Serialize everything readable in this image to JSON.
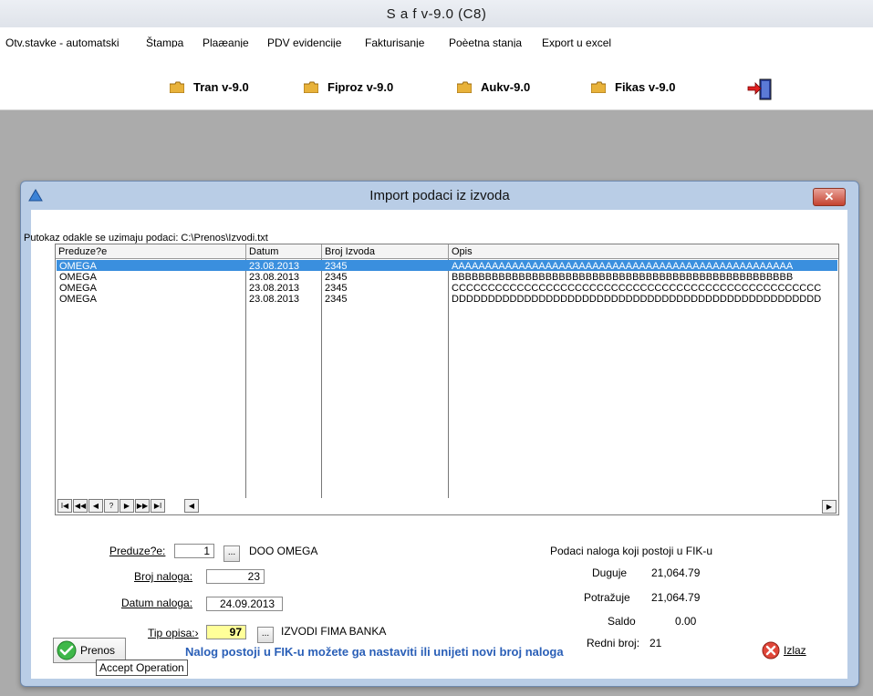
{
  "app": {
    "title": "S a f  v-9.0 (C8)"
  },
  "menu": [
    "Otv.stavke - automatski",
    "Štampa",
    "Plaæanje",
    "PDV evidencije",
    "Fakturisanje",
    "Poèetna stanja",
    "Export u excel"
  ],
  "toolbar": {
    "buttons": [
      "Tran v-9.0",
      "Fiproz v-9.0",
      "Aukv-9.0",
      "Fikas v-9.0"
    ],
    "exit_icon": "door-exit-icon"
  },
  "dialog": {
    "title": "Import podaci iz izvoda",
    "close_label": "✕",
    "path_label": "Putokaz odakle se uzimaju podaci: C:\\Prenos\\Izvodi.txt",
    "grid": {
      "columns": [
        "Preduze?e",
        "Datum",
        "Broj Izvoda",
        "Opis"
      ],
      "rows": [
        [
          "OMEGA",
          "23.08.2013",
          "2345",
          "AAAAAAAAAAAAAAAAAAAAAAAAAAAAAAAAAAAAAAAAAAAAAAAAAAA"
        ],
        [
          "OMEGA",
          "23.08.2013",
          "2345",
          "BBBBBBBBBBBBBBBBBBBBBBBBBBBBBBBBBBBBBBBBBBBBBBBBBBB"
        ],
        [
          "OMEGA",
          "23.08.2013",
          "2345",
          "CCCCCCCCCCCCCCCCCCCCCCCCCCCCCCCCCCCCCCCCCCCCCCCCCCC"
        ],
        [
          "OMEGA",
          "23.08.2013",
          "2345",
          "DDDDDDDDDDDDDDDDDDDDDDDDDDDDDDDDDDDDDDDDDDDDDDDDDDD"
        ]
      ],
      "selected_row": 0,
      "nav_buttons": [
        "I◀",
        "◀◀",
        "◀",
        "?",
        "▶",
        "▶▶",
        "▶I"
      ],
      "scroll_left": "◀",
      "scroll_right": "▶"
    },
    "form": {
      "preduzece_label": "Preduze?e:",
      "preduzece_value": "1",
      "preduzece_name": "DOO OMEGA",
      "broj_naloga_label": "Broj naloga:",
      "broj_naloga_value": "23",
      "datum_naloga_label": "Datum naloga:",
      "datum_naloga_value": "24.09.2013",
      "tip_opisa_label": "Tip opisa:›",
      "tip_opisa_value": "97",
      "tip_opisa_name": "IZVODI FIMA BANKA",
      "dots": "..."
    },
    "fik": {
      "heading": "Podaci naloga koji postoji u FIK-u",
      "duguje_label": "Duguje",
      "duguje_value": "21,064.79",
      "potrazuje_label": "Potražuje",
      "potrazuje_value": "21,064.79",
      "saldo_label": "Saldo",
      "saldo_value": "0.00",
      "redni_broj_label": "Redni broj:",
      "redni_broj_value": "21"
    },
    "prenos_label": "Prenos",
    "tooltip": "Accept Operation",
    "status_message": "Nalog postoji u FIK-u možete ga nastaviti ili unijeti novi broj naloga",
    "izlaz_label": "Izlaz"
  },
  "colors": {
    "selection": "#3a8fde",
    "status_text": "#2a5fb7",
    "highlight_field": "#ffff99"
  }
}
